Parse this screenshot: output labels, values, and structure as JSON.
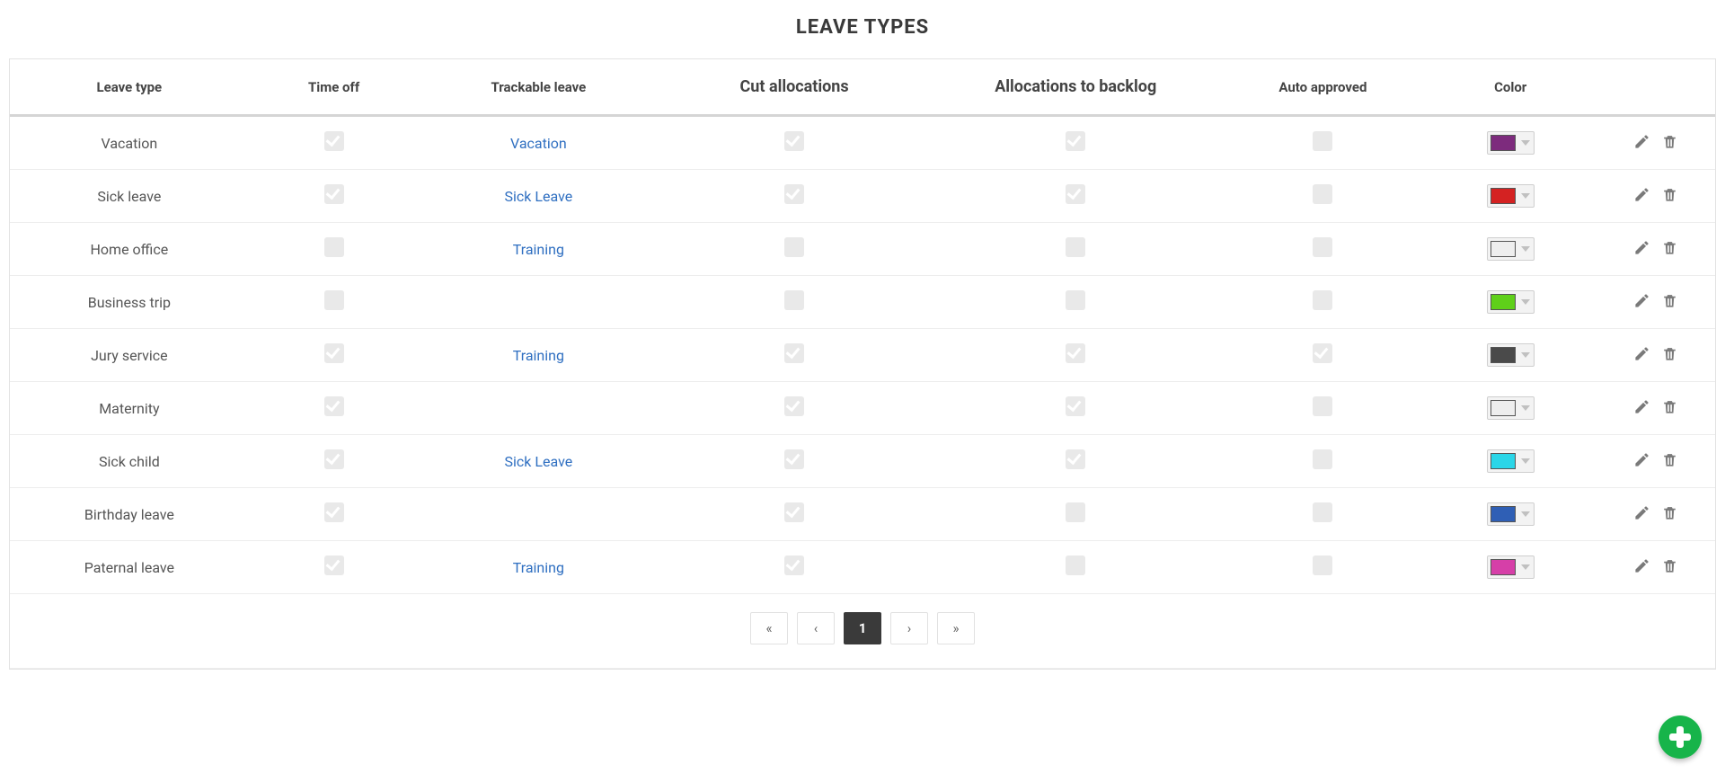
{
  "title": "LEAVE TYPES",
  "columns": {
    "leave_type": "Leave type",
    "time_off": "Time off",
    "trackable": "Trackable leave",
    "cut_alloc": "Cut allocations",
    "alloc_backlog": "Allocations to backlog",
    "auto_approved": "Auto approved",
    "color": "Color"
  },
  "rows": [
    {
      "name": "Vacation",
      "time_off": true,
      "trackable": "Vacation",
      "cut": true,
      "backlog": true,
      "auto": false,
      "color": "#7d2b7d"
    },
    {
      "name": "Sick leave",
      "time_off": true,
      "trackable": "Sick Leave",
      "cut": true,
      "backlog": true,
      "auto": false,
      "color": "#d42222"
    },
    {
      "name": "Home office",
      "time_off": false,
      "trackable": "Training",
      "cut": false,
      "backlog": false,
      "auto": false,
      "color": "#eeeeee"
    },
    {
      "name": "Business trip",
      "time_off": false,
      "trackable": "",
      "cut": false,
      "backlog": false,
      "auto": false,
      "color": "#5fd01a"
    },
    {
      "name": "Jury service",
      "time_off": true,
      "trackable": "Training",
      "cut": true,
      "backlog": true,
      "auto": true,
      "color": "#4a4a4a"
    },
    {
      "name": "Maternity",
      "time_off": true,
      "trackable": "",
      "cut": true,
      "backlog": true,
      "auto": false,
      "color": "#eeeeee"
    },
    {
      "name": "Sick child",
      "time_off": true,
      "trackable": "Sick Leave",
      "cut": true,
      "backlog": true,
      "auto": false,
      "color": "#2bd6e8"
    },
    {
      "name": "Birthday leave",
      "time_off": true,
      "trackable": "",
      "cut": true,
      "backlog": false,
      "auto": false,
      "color": "#2f5fb5"
    },
    {
      "name": "Paternal leave",
      "time_off": true,
      "trackable": "Training",
      "cut": true,
      "backlog": false,
      "auto": false,
      "color": "#d63fa8"
    }
  ],
  "pagination": {
    "first": "«",
    "prev": "‹",
    "current": "1",
    "next": "›",
    "last": "»"
  }
}
